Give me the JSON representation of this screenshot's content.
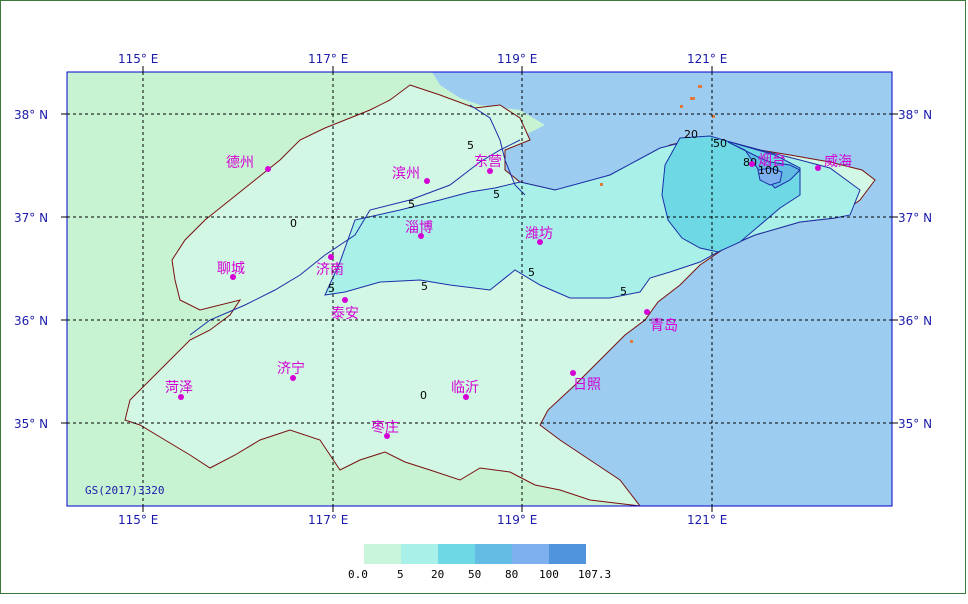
{
  "map": {
    "attribution": "GS(2017)3320",
    "longitude_labels": [
      "115° E",
      "117° E",
      "119° E",
      "121° E"
    ],
    "latitude_labels": [
      "38° N",
      "37° N",
      "36° N",
      "35° N"
    ],
    "cities": [
      {
        "name": "德州"
      },
      {
        "name": "滨州"
      },
      {
        "name": "东营"
      },
      {
        "name": "烟台"
      },
      {
        "name": "威海"
      },
      {
        "name": "淄博"
      },
      {
        "name": "潍坊"
      },
      {
        "name": "聊城"
      },
      {
        "name": "济南"
      },
      {
        "name": "泰安"
      },
      {
        "name": "青岛"
      },
      {
        "name": "济宁"
      },
      {
        "name": "菏泽"
      },
      {
        "name": "临沂"
      },
      {
        "name": "日照"
      },
      {
        "name": "枣庄"
      }
    ],
    "contour_labels": [
      "0",
      "0",
      "5",
      "5",
      "5",
      "5",
      "5",
      "5",
      "5",
      "20",
      "50",
      "80",
      "100"
    ]
  },
  "legend": {
    "colors": [
      "#c8f5dc",
      "#a8f0e8",
      "#6ed8e4",
      "#62bce4",
      "#7eb0f0",
      "#4f94dc"
    ],
    "labels": [
      "0.0",
      "5",
      "20",
      "50",
      "80",
      "100",
      "107.3"
    ]
  }
}
